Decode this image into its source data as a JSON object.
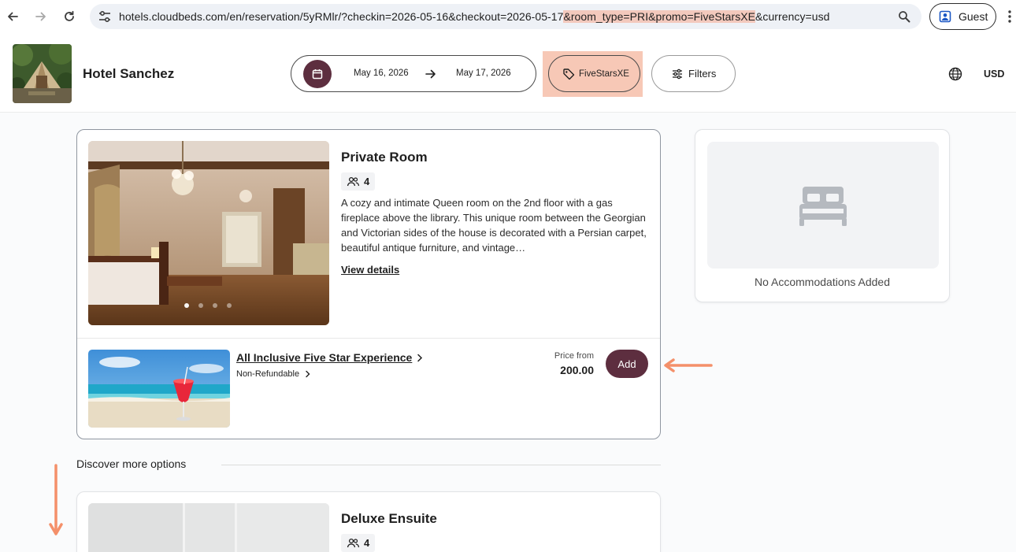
{
  "browser": {
    "url_prefix": "hotels.cloudbeds.com/en/reservation/5yRMlr/?checkin=2026-05-16&checkout=2026-05-17",
    "url_highlight": "&room_type=PRI&promo=FiveStarsXE",
    "url_suffix": "&currency=usd",
    "profile_label": "Guest"
  },
  "header": {
    "hotel_name": "Hotel Sanchez",
    "checkin": "May 16, 2026",
    "checkout": "May 17, 2026",
    "promo_code": "FiveStarsXE",
    "filters_label": "Filters",
    "currency": "USD"
  },
  "room": {
    "title": "Private Room",
    "guests": "4",
    "description": "A cozy and intimate Queen room on the 2nd floor with a gas fireplace above the library. This unique room between the Georgian and Victorian sides of the house is decorated with a Persian carpet, beautiful antique furniture, and vintage…",
    "view_details": "View details",
    "rate": {
      "name": "All Inclusive Five Star Experience",
      "policy": "Non-Refundable",
      "price_label": "Price from",
      "price": "200.00",
      "add_label": "Add"
    }
  },
  "side_panel": {
    "empty_text": "No Accommodations Added"
  },
  "discover": {
    "heading": "Discover more options"
  },
  "room2": {
    "title": "Deluxe Ensuite",
    "guests": "4"
  },
  "colors": {
    "brand": "#5d2e3f",
    "highlight": "#f7c8b6",
    "annotation": "#f4906a"
  }
}
